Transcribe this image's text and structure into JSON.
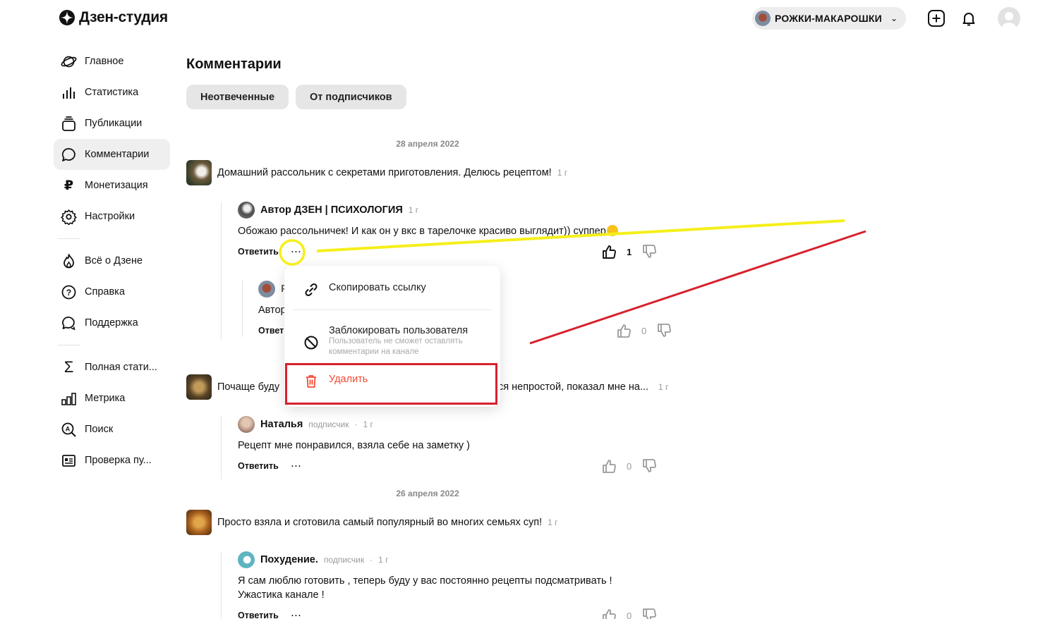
{
  "app": {
    "title": "Дзен-студия"
  },
  "header": {
    "channel_name": "РОЖКИ-МАКАРОШКИ"
  },
  "sidebar": {
    "items": [
      {
        "label": "Главное",
        "icon": "planet-icon"
      },
      {
        "label": "Статистика",
        "icon": "bar-chart-icon"
      },
      {
        "label": "Публикации",
        "icon": "publications-stack-icon"
      },
      {
        "label": "Комментарии",
        "icon": "comment-bubble-icon",
        "active": true
      },
      {
        "label": "Монетизация",
        "icon": "ruble-icon"
      },
      {
        "label": "Настройки",
        "icon": "gear-icon"
      }
    ],
    "items2": [
      {
        "label": "Всё о Дзене",
        "icon": "flame-icon"
      },
      {
        "label": "Справка",
        "icon": "question-icon"
      },
      {
        "label": "Поддержка",
        "icon": "support-chat-icon"
      }
    ],
    "items3": [
      {
        "label": "Полная стати...",
        "icon": "sigma-icon"
      },
      {
        "label": "Метрика",
        "icon": "metrika-icon"
      },
      {
        "label": "Поиск",
        "icon": "search-icon"
      },
      {
        "label": "Проверка пу...",
        "icon": "check-publication-icon"
      }
    ]
  },
  "main": {
    "title": "Комментарии",
    "filters": [
      "Неотвеченные",
      "От подписчиков"
    ],
    "dates": [
      "28 апреля 2022",
      "26 апреля 2022"
    ],
    "posts": [
      {
        "title": "Домашний рассольник с секретами приготовления. Делюсь рецептом!",
        "age": "1 г",
        "comment": {
          "author": "Автор ДЗЕН | ПСИХОЛОГИЯ",
          "age": "1 г",
          "text": "Обожаю рассольничек! И как он у вкс в тарелочке красиво выглядит)) суппер",
          "reply": "Ответить",
          "more": "···",
          "likes": "1"
        },
        "nested": {
          "author_partial": "Р",
          "text_partial": "Автор",
          "reply_partial": "Ответ",
          "likes": "0"
        }
      },
      {
        "title_left": "Почаще буду",
        "title_right": "ся непростой, показал мне на...",
        "age": "1 г",
        "comment": {
          "author": "Наталья",
          "role": "подписчик",
          "age": "1 г",
          "text": "Рецепт мне понравился, взяла себе на заметку )",
          "reply": "Ответить",
          "more": "···",
          "likes": "0"
        }
      },
      {
        "title": "Просто взяла и сготовила самый популярный во многих семьях суп!",
        "age": "1 г",
        "comment": {
          "author": "Похудение.",
          "role": "подписчик",
          "age": "1 г",
          "text_line1": "Я сам люблю готовить , теперь буду у вас постоянно рецепты подсматривать !",
          "text_line2": "Ужастика канале !",
          "reply": "Ответить",
          "more": "···",
          "likes": "0"
        }
      }
    ]
  },
  "context_menu": {
    "copy_link": "Скопировать ссылку",
    "block_user": "Заблокировать пользователя",
    "block_user_hint": "Пользователь не сможет оставлять комментарии на канале",
    "delete": "Удалить"
  },
  "colors": {
    "danger": "#f24a35",
    "annotation_yellow": "#f5ef1a",
    "annotation_red": "#d8202c"
  }
}
